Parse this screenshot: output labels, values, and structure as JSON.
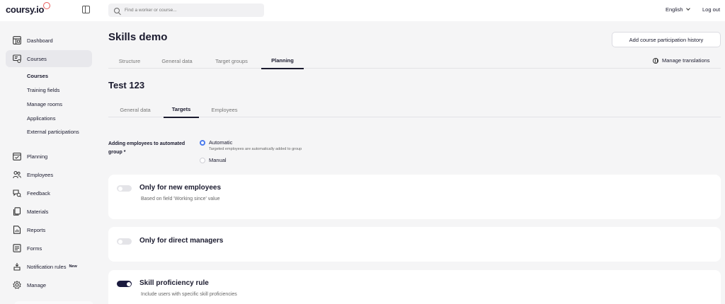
{
  "header": {
    "logo": "coursy.io",
    "search_placeholder": "Find a worker or course...",
    "language": "English",
    "logout": "Log out"
  },
  "sidebar": {
    "items": [
      {
        "label": "Dashboard",
        "icon": "dashboard-icon"
      },
      {
        "label": "Courses",
        "icon": "courses-icon",
        "active": true
      },
      {
        "label": "Planning",
        "icon": "planning-icon"
      },
      {
        "label": "Employees",
        "icon": "employees-icon"
      },
      {
        "label": "Feedback",
        "icon": "feedback-icon"
      },
      {
        "label": "Materials",
        "icon": "materials-icon"
      },
      {
        "label": "Reports",
        "icon": "reports-icon"
      },
      {
        "label": "Forms",
        "icon": "forms-icon"
      },
      {
        "label": "Notification rules",
        "icon": "notification-rules-icon",
        "badge": "New"
      },
      {
        "label": "Manage",
        "icon": "manage-icon"
      }
    ],
    "courses_submenu": [
      "Courses",
      "Training fields",
      "Manage rooms",
      "Applications",
      "External participations"
    ]
  },
  "main": {
    "title": "Skills demo",
    "add_history_button": "Add course participation history",
    "tabs": [
      "Structure",
      "General data",
      "Target groups",
      "Planning"
    ],
    "active_tab": "Planning",
    "manage_translations": "Manage translations",
    "section_title": "Test 123",
    "subtabs": [
      "General data",
      "Targets",
      "Employees"
    ],
    "active_subtab": "Targets",
    "adding_label": "Adding employees to automated group *",
    "options": {
      "automatic": "Automatic",
      "automatic_hint": "Targeted employees are automatically added to group",
      "manual": "Manual",
      "selected": "automatic"
    },
    "rules": [
      {
        "title": "Only for new employees",
        "description": "Based on field 'Working since' value",
        "enabled": false
      },
      {
        "title": "Only for direct managers",
        "description": "",
        "enabled": false
      },
      {
        "title": "Skill proficiency rule",
        "description": "Include users with specific skill proficiencies",
        "enabled": true
      }
    ]
  },
  "colors": {
    "accent": "#4b7bec",
    "toggle_on": "#1a1a3e",
    "logo_badge": "#e85a5a",
    "background": "#f5f5f6"
  }
}
